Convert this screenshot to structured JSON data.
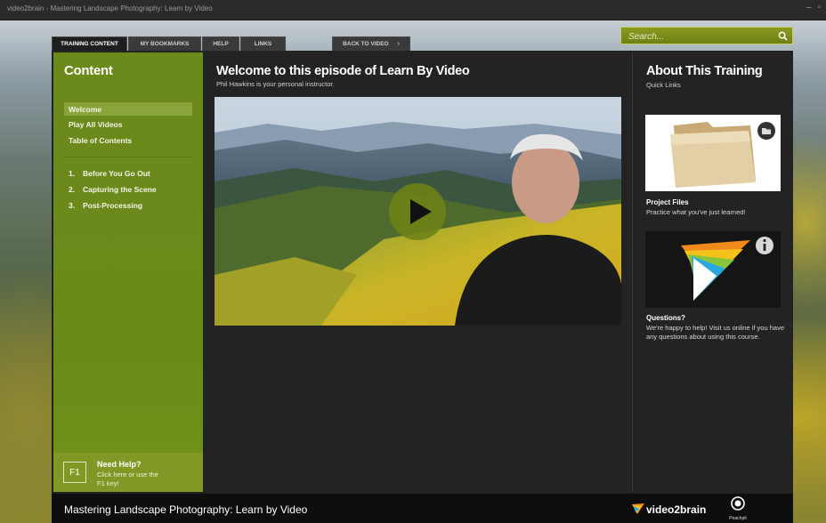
{
  "window": {
    "title": "video2brain - Mastering Landscape Photography: Learn by Video"
  },
  "tabs": [
    {
      "label": "Training Content",
      "active": true
    },
    {
      "label": "My Bookmarks",
      "active": false
    },
    {
      "label": "Help",
      "active": false
    },
    {
      "label": "Links",
      "active": false
    }
  ],
  "back_to_video": {
    "label": "Back to Video",
    "chevron": "›"
  },
  "search": {
    "placeholder": "Search...",
    "icon": "search-icon"
  },
  "sidebar": {
    "heading": "Content",
    "items": [
      {
        "label": "Welcome",
        "selected": true
      },
      {
        "label": "Play All Videos",
        "selected": false
      },
      {
        "label": "Table of Contents",
        "selected": false
      }
    ],
    "chapters": [
      {
        "num": "1.",
        "label": "Before You Go Out"
      },
      {
        "num": "2.",
        "label": "Capturing the Scene"
      },
      {
        "num": "3.",
        "label": "Post-Processing"
      }
    ],
    "help": {
      "key": "F1",
      "title": "Need Help?",
      "text": "Click here or use the F1 key!"
    }
  },
  "main": {
    "title": "Welcome to this episode of Learn By Video",
    "subtitle": "Phil Hawkins is your personal instructor."
  },
  "right": {
    "title": "About This Training",
    "subtitle": "Quick Links",
    "project_files": {
      "title": "Project Files",
      "text": "Practice what you've just learned!"
    },
    "questions": {
      "title": "Questions?",
      "text": "We're happy to help! Visit us online if you have any questions about using this course."
    }
  },
  "footer": {
    "title": "Mastering Landscape Photography: Learn by Video",
    "brand": "video2brain",
    "publisher": "Peachpit"
  },
  "colors": {
    "accent_green": "#6c8a1c",
    "panel_dark": "#232323",
    "footer": "#0e0e0e"
  }
}
